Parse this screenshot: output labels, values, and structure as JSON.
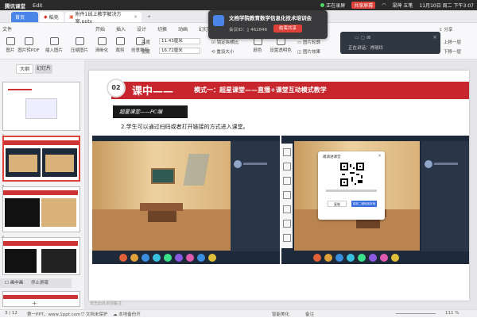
{
  "menubar": {
    "app": "腾讯课堂",
    "menu1": "Edit",
    "rec_label": "正在录屏",
    "status": "共享屏幕",
    "clock": "11月10日 周二 下午3:07",
    "user": "梁神 五笔"
  },
  "tabs": {
    "home": "首页",
    "docer": "稻壳",
    "file": "附件1线上教学解决方案.pptx"
  },
  "ribbon": {
    "file_menu": "文件",
    "tabs": [
      "开始",
      "插入",
      "设计",
      "切换",
      "动画",
      "幻灯片放映",
      "审阅"
    ],
    "buttons": [
      "图片",
      "图片转PDF",
      "插入图片",
      "压缩图片",
      "清晰化",
      "裁剪",
      "创意裁剪"
    ],
    "height_label": "高度",
    "height_value": "11.43厘米",
    "width_label": "宽度",
    "width_value": "16.72厘米",
    "lock_ratio": "锁定纵横比",
    "reset_size": "重设大小",
    "color_label": "颜色",
    "rotate_label": "旋转",
    "set_transparent": "设置透明色",
    "outline": "图片轮廓",
    "effect": "图片效果",
    "combine": "组合",
    "selection": "选择窗格",
    "up_layer": "上移一层",
    "down_layer": "下移一层",
    "share": "分享"
  },
  "popup": {
    "title": "文档学院教育数学信息化技术培训会",
    "meeting_label": "会议ID：",
    "meeting_id": "▯ 462846",
    "end_button": "结束共享"
  },
  "meetwin": {
    "status": "正在讲话：",
    "speaker": "肖晓玲"
  },
  "left_panel": {
    "outline_tab": "大纲",
    "slides_tab": "幻灯片",
    "slide_numbers": [
      "",
      "2",
      "3",
      "4",
      "5",
      "6"
    ],
    "pip_label": "画中画",
    "share_label": "停止屏幕"
  },
  "slide": {
    "number": "02",
    "heading": "课中——",
    "heading_sub": "模式一：超星课堂——直播+课堂互动模式教学",
    "banner": "超星课堂——PC端",
    "body": "2.学生可以通过扫码或者打开链接的方式进入课堂。",
    "dialog_title": "邀请进课堂",
    "copy_link": "复制",
    "save_qr": "保存二维码到本地",
    "note_placeholder": "单击此处添加备注"
  },
  "statusbar": {
    "page": "3 / 12",
    "theme": "第一PPT，www.1ppt.com",
    "protect": "文档未保护",
    "backup": "本地备份开",
    "smart": "智能美化",
    "notes": "备注",
    "zoom": "111 %"
  }
}
